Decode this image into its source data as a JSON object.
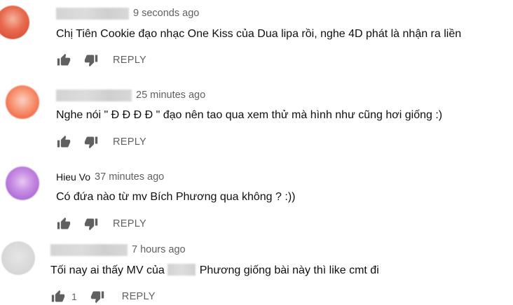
{
  "comments": [
    {
      "author": "",
      "author_redacted": true,
      "time": "9 seconds ago",
      "text": "Chị Tiên Cookie đạo nhạc One Kiss của Dua lipa rồi, nghe 4D phát là nhận ra liền",
      "likes": "",
      "reply_label": "REPLY",
      "like_icon": "thumb-up-icon",
      "dislike_icon": "thumb-down-icon"
    },
    {
      "author": "",
      "author_redacted": true,
      "time": "25 minutes ago",
      "text": "Nghe nói \" Đ Đ Đ Đ \" đạo nên tao qua xem thử mà hình như cũng hơi giống :)",
      "likes": "",
      "reply_label": "REPLY",
      "like_icon": "thumb-up-icon",
      "dislike_icon": "thumb-down-icon"
    },
    {
      "author": "Hieu Vo",
      "author_redacted": false,
      "time": "37 minutes ago",
      "text": "Có đứa nào từ mv Bích Phương qua không ? :))",
      "likes": "",
      "reply_label": "REPLY",
      "like_icon": "thumb-up-icon",
      "dislike_icon": "thumb-down-icon"
    },
    {
      "author": "",
      "author_redacted": true,
      "time": "7 hours ago",
      "text_before": "Tối nay ai thấy MV của",
      "text_after": "Phương giống bài này thì like cmt đi",
      "likes": "1",
      "reply_label": "REPLY",
      "like_icon": "thumb-up-icon",
      "dislike_icon": "thumb-down-icon"
    }
  ],
  "colors": {
    "text": "#0f0f0f",
    "secondary": "#606060",
    "background": "#ffffff"
  }
}
